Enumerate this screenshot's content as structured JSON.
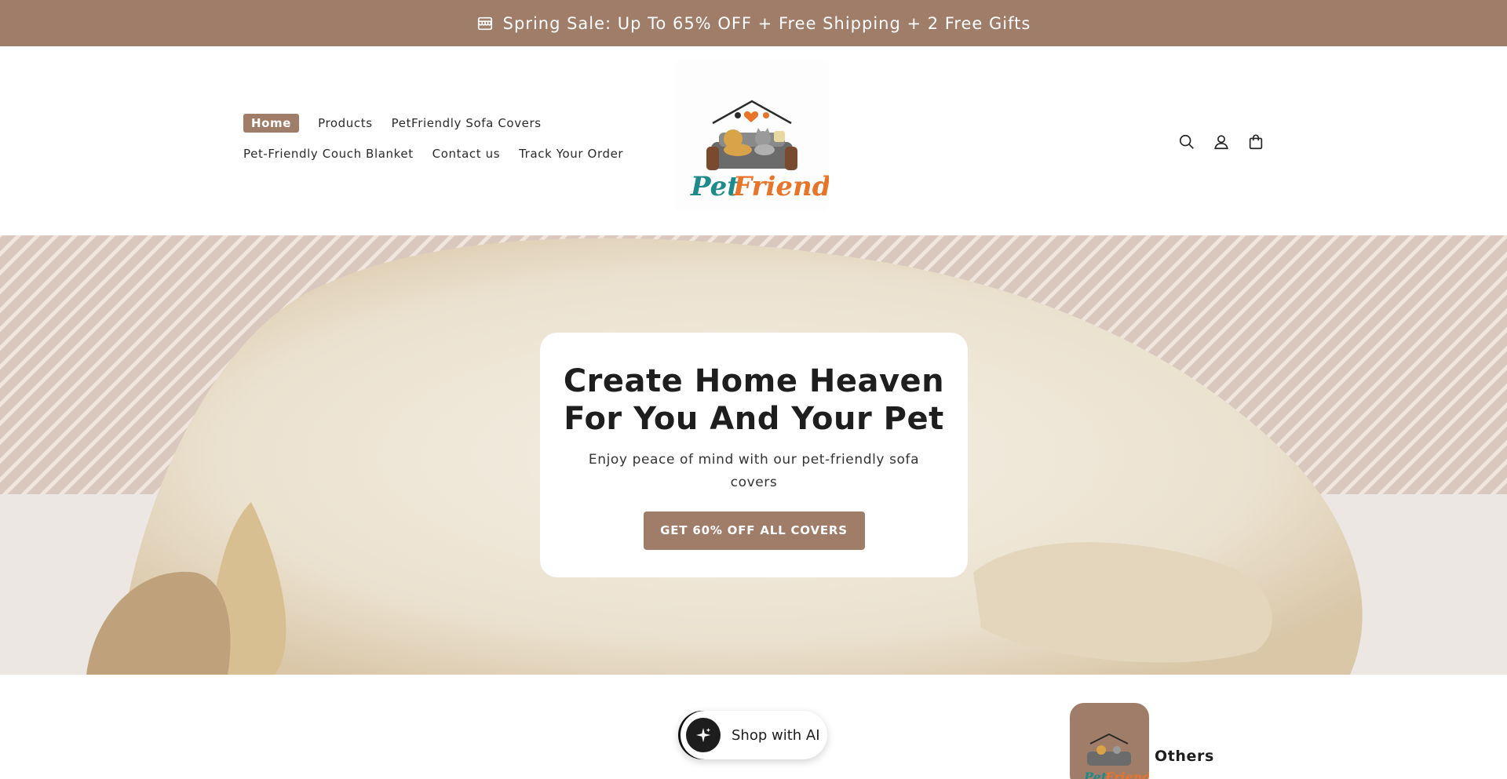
{
  "announcement": {
    "text": "Spring Sale: Up To 65% OFF + Free Shipping + 2 Free Gifts",
    "icon": "store-icon"
  },
  "header": {
    "nav": {
      "row1": [
        {
          "label": "Home",
          "active": true
        },
        {
          "label": "Products",
          "active": false
        },
        {
          "label": "PetFriendly Sofa Covers",
          "active": false
        }
      ],
      "row2": [
        {
          "label": "Pet-Friendly Couch Blanket",
          "active": false
        },
        {
          "label": "Contact us",
          "active": false
        },
        {
          "label": "Track Your Order",
          "active": false
        }
      ]
    },
    "logo": {
      "text_pet": "Pet",
      "text_friendly": "Friendly"
    },
    "icons": [
      "search-icon",
      "account-icon",
      "cart-icon"
    ]
  },
  "hero": {
    "title_line1": "Create Home Heaven",
    "title_line2": "For You And Your Pet",
    "subtitle": "Enjoy peace of mind with our pet-friendly sofa covers",
    "cta_label": "GET 60% OFF ALL COVERS"
  },
  "below": {
    "ai_button_label": "Shop with AI",
    "category_label": "Others"
  },
  "colors": {
    "brand": "#9f7d69",
    "text": "#222222",
    "logo_teal": "#1f8a8a",
    "logo_orange": "#e8742a"
  }
}
